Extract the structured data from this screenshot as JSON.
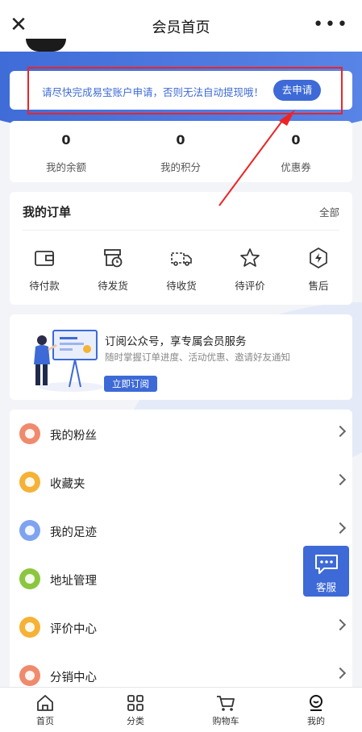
{
  "header": {
    "close_icon": "close-icon",
    "title": "会员首页",
    "more_icon": "more-icon",
    "more_glyph": "•••"
  },
  "notice": {
    "text": "请尽快完成易宝账户申请，否则无法自动提现哦！",
    "button": "去申请",
    "highlight_color": "#ee2424"
  },
  "stats": [
    {
      "value": "0",
      "label": "我的余额"
    },
    {
      "value": "0",
      "label": "我的积分"
    },
    {
      "value": "0",
      "label": "优惠券"
    }
  ],
  "orders": {
    "title": "我的订单",
    "all": "全部",
    "items": [
      {
        "label": "待付款",
        "icon": "wallet-icon"
      },
      {
        "label": "待发货",
        "icon": "box-clock-icon"
      },
      {
        "label": "待收货",
        "icon": "truck-icon"
      },
      {
        "label": "待评价",
        "icon": "star-icon"
      },
      {
        "label": "售后",
        "icon": "shield-bolt-icon"
      }
    ]
  },
  "subscribe": {
    "title": "订阅公众号，享专属会员服务",
    "desc": "随时掌握订单进度、活动优惠、邀请好友通知",
    "button": "立即订阅"
  },
  "menu": [
    {
      "label": "我的粉丝",
      "icon": "fans-icon",
      "color": "#f08a6c"
    },
    {
      "label": "收藏夹",
      "icon": "favorites-icon",
      "color": "#f5b236"
    },
    {
      "label": "我的足迹",
      "icon": "footprint-icon",
      "color": "#7ea3f0"
    },
    {
      "label": "地址管理",
      "icon": "location-icon",
      "color": "#8cc63f"
    },
    {
      "label": "评价中心",
      "icon": "comment-icon",
      "color": "#f5b236"
    },
    {
      "label": "分销中心",
      "icon": "distribution-icon",
      "color": "#f08a6c"
    }
  ],
  "service": {
    "label": "客服",
    "icon": "chat-icon"
  },
  "tabs": [
    {
      "label": "首页",
      "icon": "home-icon"
    },
    {
      "label": "分类",
      "icon": "category-icon"
    },
    {
      "label": "购物车",
      "icon": "cart-icon"
    },
    {
      "label": "我的",
      "icon": "profile-icon"
    }
  ],
  "colors": {
    "accent": "#3d6ad6",
    "background": "#f3f4f8"
  }
}
